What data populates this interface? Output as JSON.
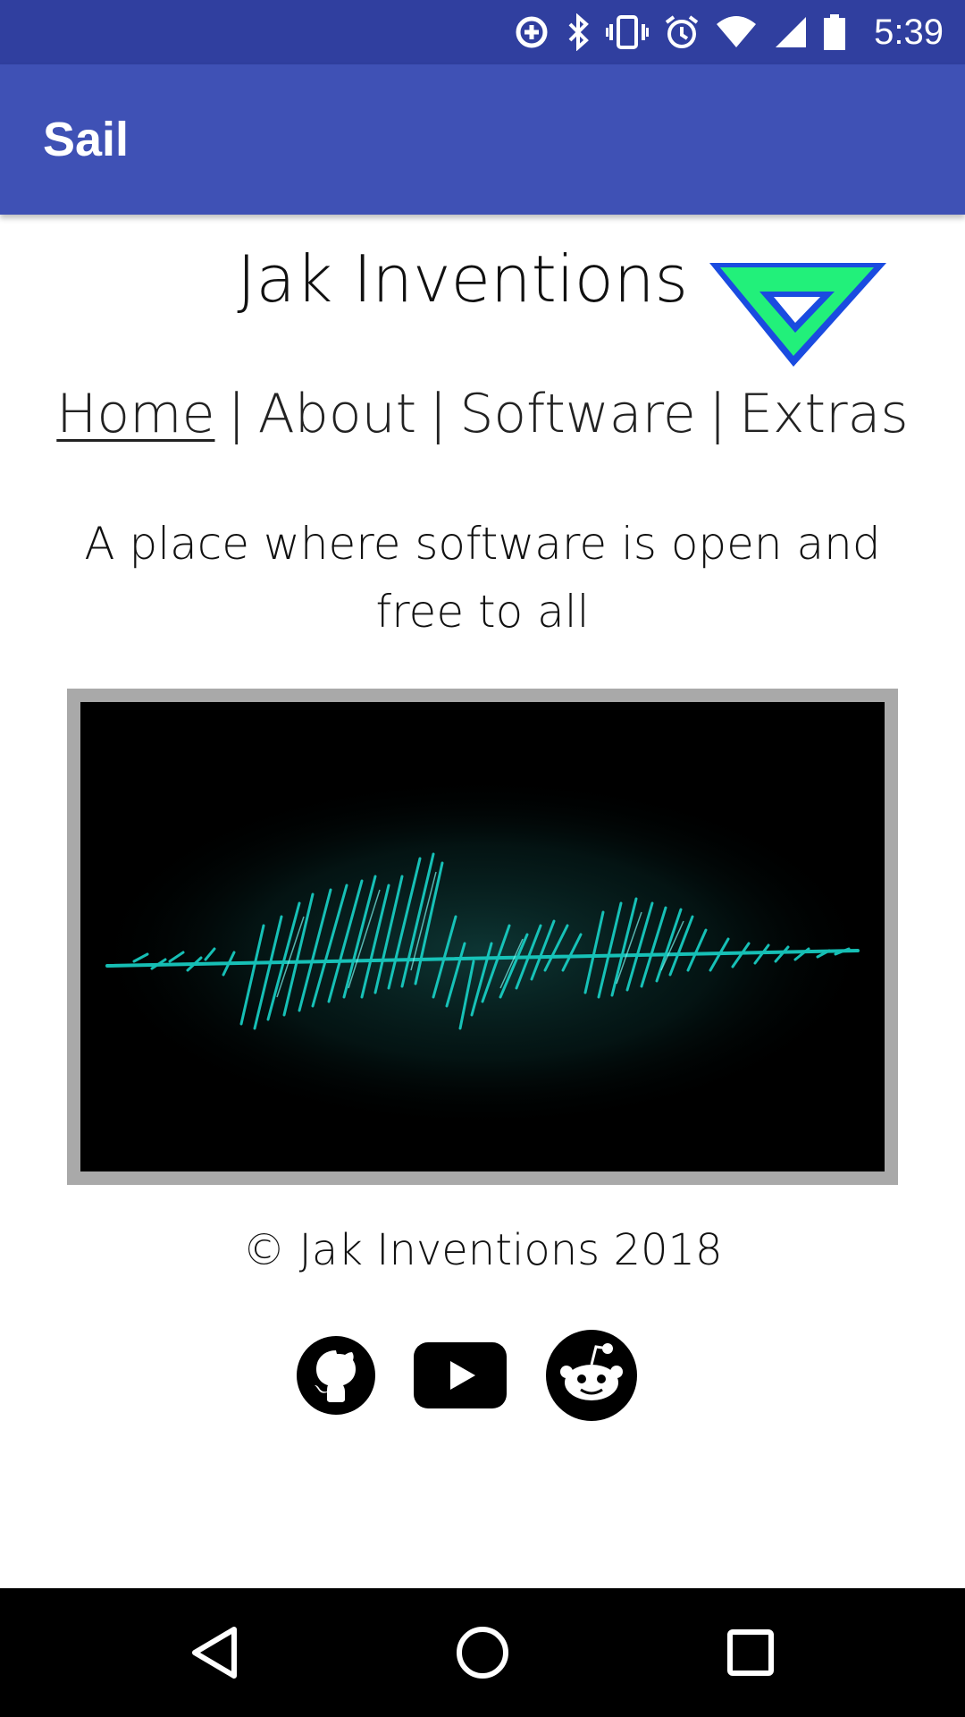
{
  "status_bar": {
    "time": "5:39",
    "icons": [
      "data-saver-icon",
      "bluetooth-icon",
      "vibrate-icon",
      "alarm-icon",
      "wifi-icon",
      "cell-signal-icon",
      "battery-icon"
    ]
  },
  "app_bar": {
    "title": "Sail",
    "color": "#3f51b5",
    "status_color": "#303f9f"
  },
  "page": {
    "brand": "Jak Inventions",
    "nav": [
      {
        "label": "Home",
        "active": true
      },
      {
        "label": "About",
        "active": false
      },
      {
        "label": "Software",
        "active": false
      },
      {
        "label": "Extras",
        "active": false
      }
    ],
    "nav_separator": "|",
    "tagline": "A place where software is open and free to all",
    "copyright": "© Jak Inventions 2018",
    "social": [
      "github-icon",
      "youtube-icon",
      "reddit-icon"
    ],
    "accent_colors": {
      "logo_fill": "#22f07a",
      "logo_stroke": "#1a4be0",
      "wave": "#19d3c8"
    }
  },
  "system_nav": {
    "buttons": [
      "back-button",
      "home-button",
      "recents-button"
    ]
  }
}
